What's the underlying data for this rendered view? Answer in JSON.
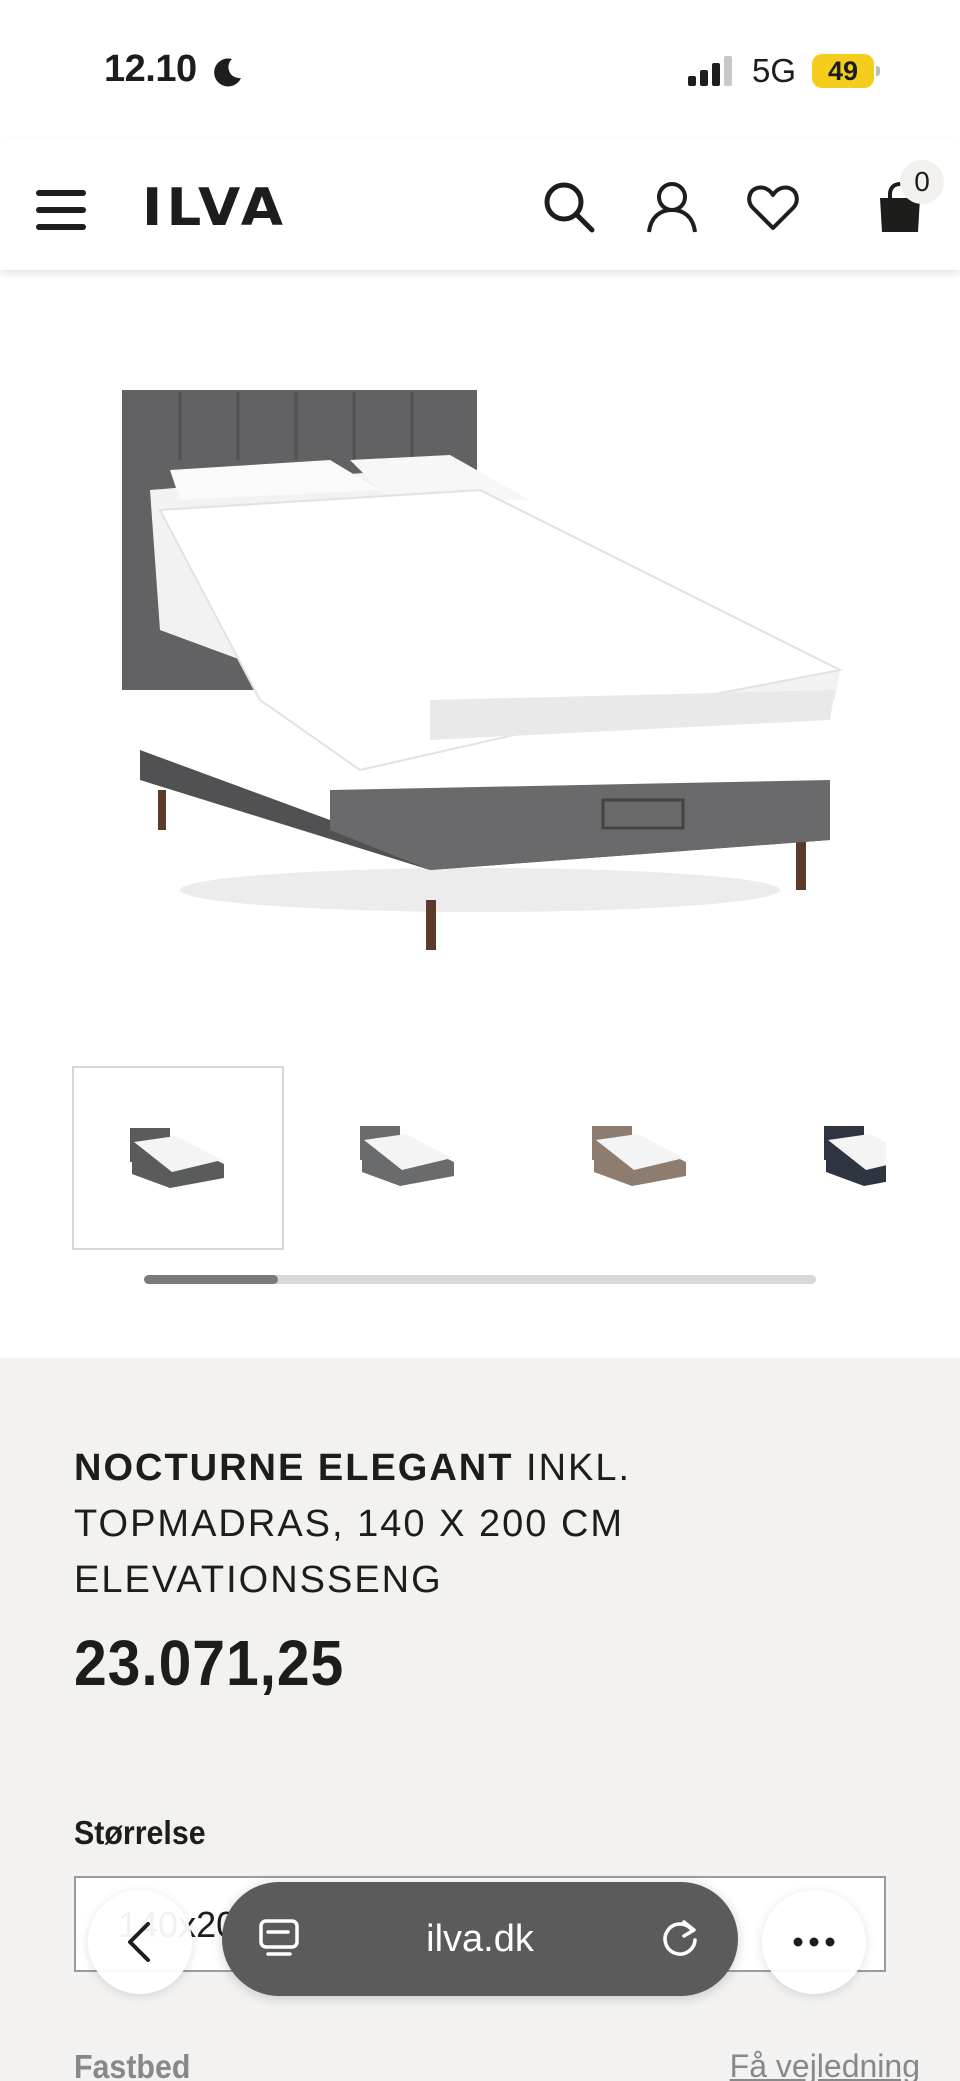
{
  "status_bar": {
    "time": "12.10",
    "network": "5G",
    "battery": "49"
  },
  "header": {
    "logo": "ILVA",
    "cart_count": "0",
    "icons": [
      "menu-icon",
      "search-icon",
      "account-icon",
      "heart-icon",
      "bag-icon"
    ]
  },
  "gallery": {
    "thumbnails": [
      {
        "color": "#5a5b5d"
      },
      {
        "color": "#6a6b6d"
      },
      {
        "color": "#8e7c6e"
      },
      {
        "color": "#2f3441"
      }
    ],
    "scroll_fraction": 0.2
  },
  "product": {
    "brand": "NOCTURNE ELEGANT",
    "title_rest": " INKL. TOPMADRAS, 140 X 200 CM ELEVATIONSSENG",
    "price": "23.071,25",
    "size_label": "Størrelse",
    "size_value": "140x200",
    "firmness_label": "Fastbed",
    "guide_link": "Få vejledning"
  },
  "browser": {
    "url": "ilva.dk"
  }
}
